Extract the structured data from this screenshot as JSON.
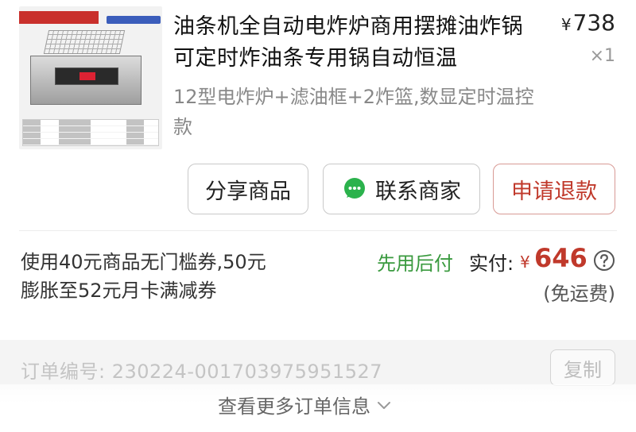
{
  "product": {
    "title": "油条机全自动电炸炉商用摆摊油炸锅可定时炸油条专用锅自动恒温",
    "price_symbol": "¥",
    "price": "738",
    "quantity": "×1",
    "variant": "12型电炸炉+滤油框+2炸篮,数显定时温控款",
    "image_icon": "product-thumbnail-fryer"
  },
  "actions": {
    "share_label": "分享商品",
    "contact_label": "联系商家",
    "refund_label": "申请退款"
  },
  "payment": {
    "coupon_text": "使用40元商品无门槛券,50元膨胀至52元月卡满减券",
    "pay_later_label": "先用后付",
    "paid_label": "实付:",
    "paid_symbol": "¥",
    "paid_amount": "646",
    "shipping_note": "(免运费)"
  },
  "order": {
    "number_text": "订单编号:  230224-001703975951527",
    "copy_label": "复制",
    "more_label": "查看更多订单信息"
  },
  "colors": {
    "accent_red": "#c0392b",
    "pay_later_green": "#3a9a3f",
    "wechat_green": "#2bb24c"
  }
}
